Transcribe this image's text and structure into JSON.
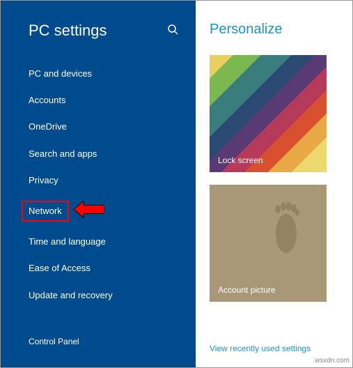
{
  "sidebar": {
    "title": "PC settings",
    "items": [
      {
        "label": "PC and devices"
      },
      {
        "label": "Accounts"
      },
      {
        "label": "OneDrive"
      },
      {
        "label": "Search and apps"
      },
      {
        "label": "Privacy"
      },
      {
        "label": "Network"
      },
      {
        "label": "Time and language"
      },
      {
        "label": "Ease of Access"
      },
      {
        "label": "Update and recovery"
      }
    ],
    "footer_link": "Control Panel"
  },
  "content": {
    "title": "Personalize",
    "tiles": {
      "lock_screen": "Lock screen",
      "account_picture": "Account picture"
    },
    "recent_link": "View recently used settings"
  },
  "watermark": "wsxdn.com"
}
